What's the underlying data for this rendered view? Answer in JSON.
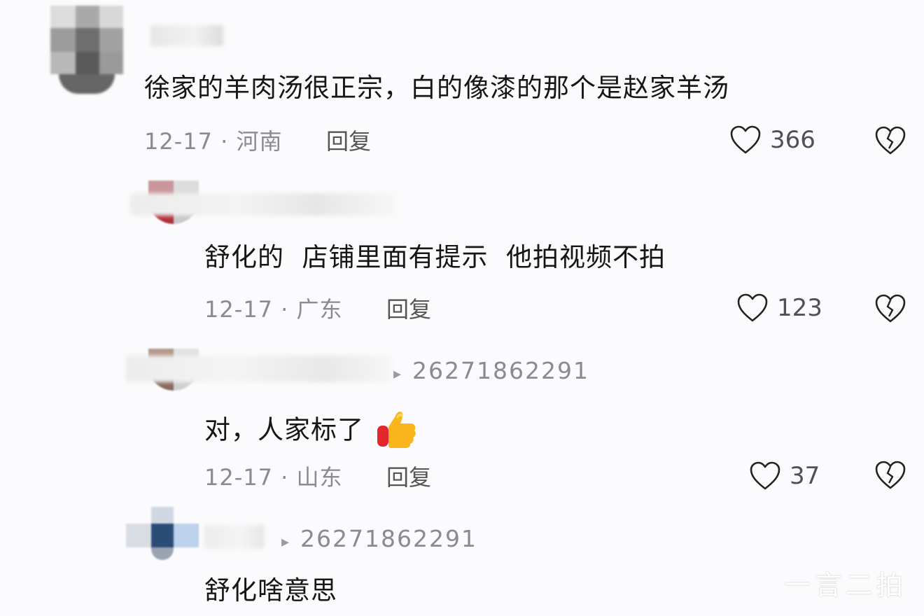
{
  "comments": [
    {
      "text": "徐家的羊肉汤很正宗，白的像漆的那个是赵家羊汤",
      "date_location": "12-17 · 河南",
      "reply_label": "回复",
      "likes": "366"
    },
    {
      "text": "舒化的  店铺里面有提示  他拍视频不拍",
      "date_location": "12-17 · 广东",
      "reply_label": "回复",
      "likes": "123"
    },
    {
      "reply_to": "26271862291",
      "text": "对，人家标了",
      "emoji": "thumbs-up",
      "date_location": "12-17 · 山东",
      "reply_label": "回复",
      "likes": "37"
    },
    {
      "reply_to": "26271862291",
      "text": "舒化啥意思"
    }
  ],
  "watermark": "一言二拍",
  "colors": {
    "background": "#fbfbfd",
    "text": "#161616",
    "meta": "#8a8a92"
  }
}
